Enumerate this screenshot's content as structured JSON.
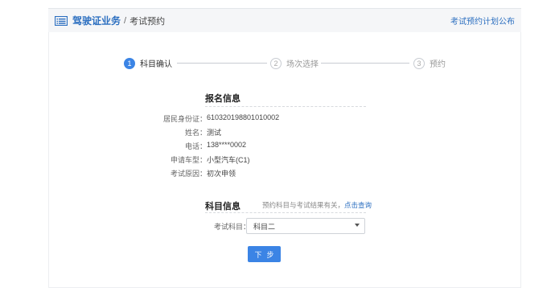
{
  "header": {
    "section": "驾驶证业务",
    "separator": "/",
    "current": "考试预约",
    "right_link": "考试预约计划公布"
  },
  "steps": [
    {
      "num": "1",
      "label": "科目确认",
      "state": "active"
    },
    {
      "num": "2",
      "label": "场次选择",
      "state": "todo"
    },
    {
      "num": "3",
      "label": "预约",
      "state": "todo"
    }
  ],
  "registration": {
    "title": "报名信息",
    "rows": [
      {
        "key": "居民身份证：",
        "value": "610320198801010002"
      },
      {
        "key": "姓名：",
        "value": "测试"
      },
      {
        "key": "电话：",
        "value": "138****0002"
      },
      {
        "key": "申请车型：",
        "value": "小型汽车(C1)"
      },
      {
        "key": "考试原因：",
        "value": "初次申领"
      }
    ]
  },
  "subject": {
    "title": "科目信息",
    "note": "预约科目与考试结果有关，",
    "note_link": "点击查询",
    "field_label": "考试科目：",
    "selected": "科目二"
  },
  "buttons": {
    "next": "下步"
  },
  "colors": {
    "accent": "#3b84e5",
    "link": "#2c6fc0"
  }
}
